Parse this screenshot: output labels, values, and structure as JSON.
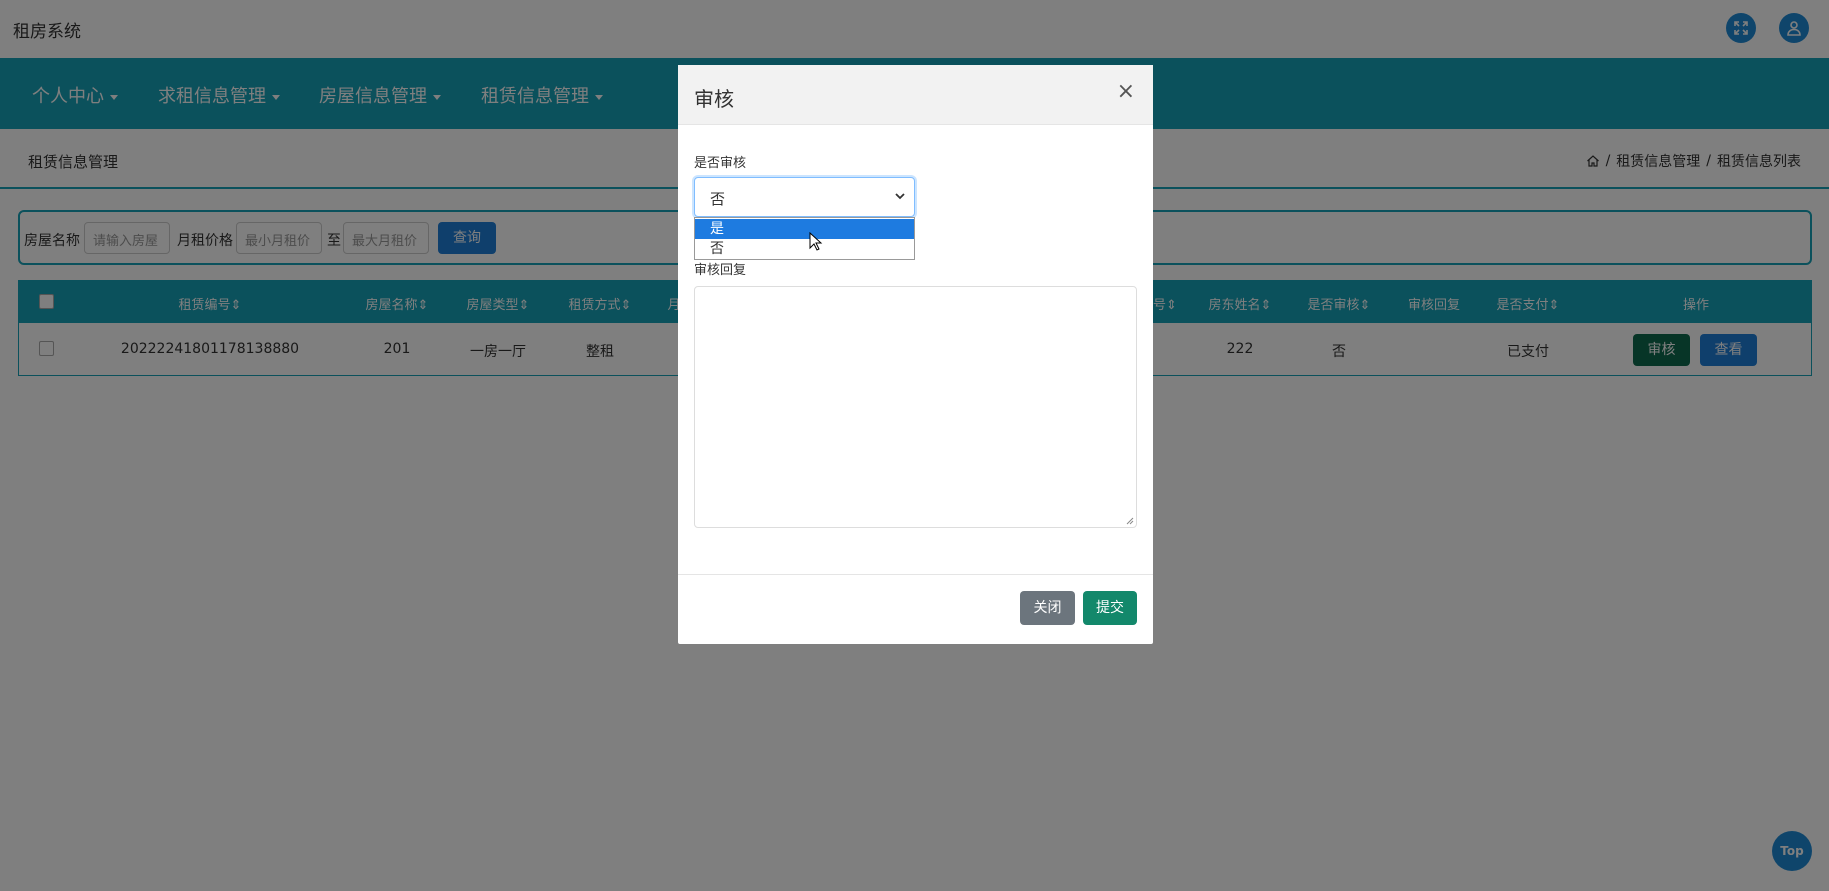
{
  "app": {
    "title": "租房系统"
  },
  "header_icons": [
    {
      "icon": "fullscreen-icon"
    },
    {
      "icon": "user-icon"
    }
  ],
  "nav": {
    "items": [
      {
        "label": "个人中心"
      },
      {
        "label": "求租信息管理"
      },
      {
        "label": "房屋信息管理"
      },
      {
        "label": "租赁信息管理"
      }
    ]
  },
  "page": {
    "title": "租赁信息管理",
    "breadcrumb": {
      "sep": "/",
      "level1": "租赁信息管理",
      "level2": "租赁信息列表",
      "home_icon": "home-icon"
    }
  },
  "search": {
    "house_name_label": "房屋名称",
    "house_name_placeholder": "请输入房屋",
    "rent_label": "月租价格",
    "min_placeholder": "最小月租价",
    "to_label": "至",
    "max_placeholder": "最大月租价",
    "query_button": "查询"
  },
  "table": {
    "headers": {
      "lease_no": "租赁编号",
      "house_name": "房屋名称",
      "house_type": "房屋类型",
      "lease_mode": "租赁方式",
      "partial_left": "月",
      "partial_right": "号",
      "landlord_name": "房东姓名",
      "audited": "是否审核",
      "audit_reply": "审核回复",
      "paid": "是否支付",
      "actions": "操作"
    },
    "row": {
      "lease_no": "20222241801178138880",
      "house_name": "201",
      "house_type": "一房一厅",
      "lease_mode": "整租",
      "landlord_name": "222",
      "audited": "否",
      "audit_reply": "",
      "paid": "已支付",
      "audit_button": "审核",
      "view_button": "查看"
    }
  },
  "modal": {
    "title": "审核",
    "close_symbol": "×",
    "audit_label": "是否审核",
    "audit_selected": "否",
    "audit_options": [
      "是",
      "否"
    ],
    "audit_highlighted": "是",
    "reply_label": "审核回复",
    "reply_value": "",
    "close_button": "关闭",
    "submit_button": "提交"
  },
  "fab": {
    "label": "Top"
  },
  "colors": {
    "primary": "#17a2b8",
    "blue": "#1e7ed8",
    "success": "#13886b",
    "secondary": "#6c757d",
    "dark_green": "#0f6b4e"
  }
}
